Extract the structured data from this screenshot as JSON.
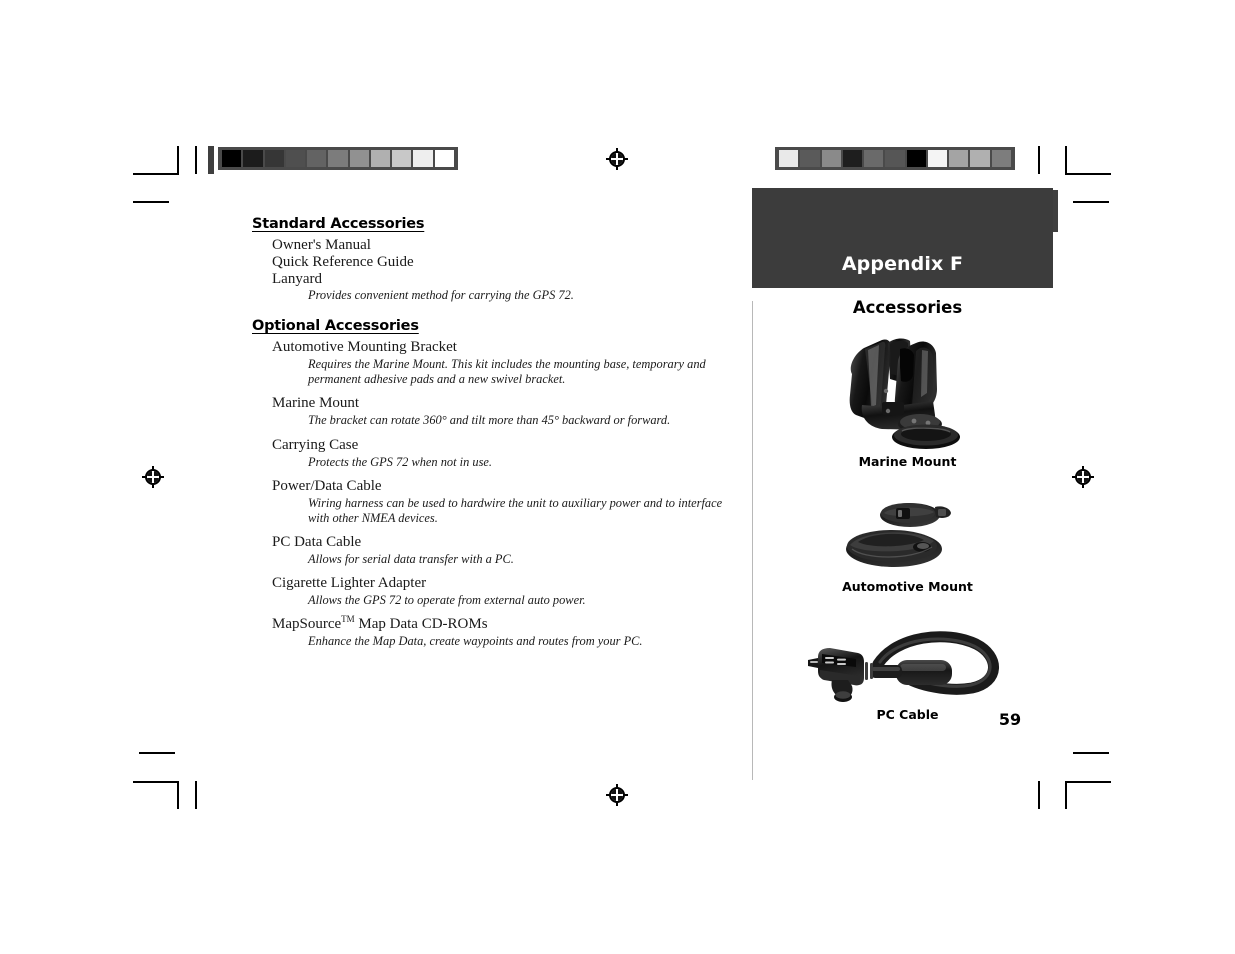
{
  "page": {
    "number": "59",
    "banner_title": "Appendix F",
    "sidebar_title": "Accessories"
  },
  "left_column": {
    "sections": [
      {
        "heading": "Standard Accessories",
        "items": [
          {
            "name": "Owner's Manual",
            "desc": ""
          },
          {
            "name": "Quick Reference Guide",
            "desc": ""
          },
          {
            "name": "Lanyard",
            "desc": "Provides convenient method for carrying the GPS 72."
          }
        ]
      },
      {
        "heading": "Optional Accessories",
        "items": [
          {
            "name": "Automotive Mounting Bracket",
            "desc": "Requires the Marine Mount.  This kit includes the mounting base, temporary and permanent adhesive pads and a new swivel bracket."
          },
          {
            "name": "Marine Mount",
            "desc": "The bracket can rotate 360° and tilt more than 45° backward or forward."
          },
          {
            "name": "Carrying Case",
            "desc": "Protects the GPS 72 when not in use."
          },
          {
            "name": "Power/Data Cable",
            "desc": "Wiring harness can be used to hardwire the unit to auxiliary power and to interface with other NMEA devices."
          },
          {
            "name": "PC Data Cable",
            "desc": "Allows for serial data transfer with a PC."
          },
          {
            "name": "Cigarette Lighter Adapter",
            "desc": "Allows the GPS 72 to operate from external auto power."
          },
          {
            "name": "MapSource",
            "name_sup": "TM",
            "name_tail": " Map Data CD-ROMs",
            "desc": "Enhance the Map Data, create waypoints and routes from your PC."
          }
        ]
      }
    ]
  },
  "sidebar_figures": [
    {
      "caption": "Marine Mount",
      "icon": "marine-mount-photo"
    },
    {
      "caption": "Automotive Mount",
      "icon": "automotive-mount-photo"
    },
    {
      "caption": "PC Cable",
      "icon": "pc-cable-photo"
    }
  ],
  "print_marks": {
    "calibration_left": {
      "label": "grayscale-step-wedge",
      "swatches": [
        "#000000",
        "#1c1c1c",
        "#363636",
        "#4f4f4f",
        "#636363",
        "#7c7c7c",
        "#919191",
        "#b0b0b0",
        "#c8c8c8",
        "#eeeeee",
        "#ffffff"
      ]
    },
    "calibration_right": {
      "label": "scrambled-step-wedge",
      "swatches": [
        "#e9e9e9",
        "#5a5a5a",
        "#8a8a8a",
        "#1e1e1e",
        "#6a6a6a",
        "#565656",
        "#000000",
        "#f4f4f4",
        "#a4a4a4",
        "#b0b0b0",
        "#7d7d7d"
      ]
    },
    "registration_mark": "registration-target"
  },
  "colors": {
    "banner_bg": "#3c3c3c",
    "rule": "#b8b8b8",
    "text": "#1a1a1a"
  }
}
